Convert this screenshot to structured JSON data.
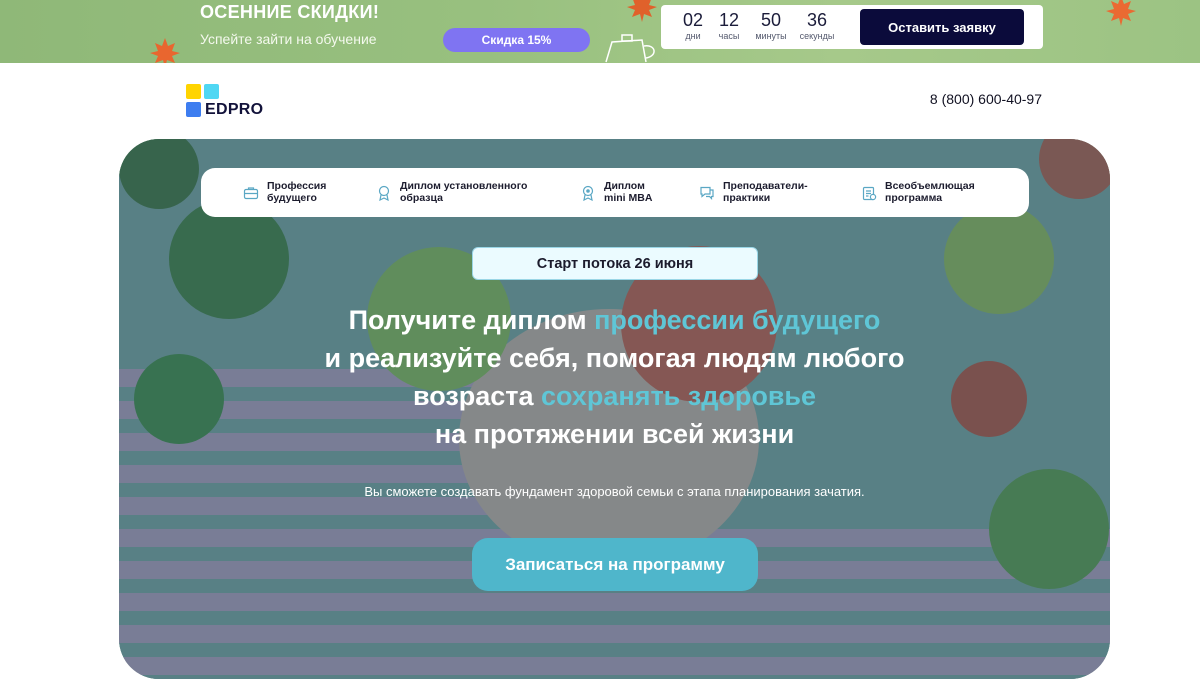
{
  "promo": {
    "title": "ОСЕННИЕ СКИДКИ!",
    "subtitle": "Успейте зайти на обучение",
    "discount_badge": "Скидка 15%",
    "timer": [
      {
        "value": "02",
        "label": "дни"
      },
      {
        "value": "12",
        "label": "часы"
      },
      {
        "value": "50",
        "label": "минуты"
      },
      {
        "value": "36",
        "label": "секунды"
      }
    ],
    "cta_label": "Оставить заявку",
    "colors": {
      "badge": "#7f74f2",
      "cta": "#0b0b3b",
      "leaf": "#e9662f"
    }
  },
  "header": {
    "logo_text": "EDPRO",
    "phone": "8 (800) 600-40-97"
  },
  "features": [
    {
      "icon": "briefcase-icon",
      "label": "Профессия\nбудущего"
    },
    {
      "icon": "award-icon",
      "label": "Диплом установленного\nобразца"
    },
    {
      "icon": "medal-icon",
      "label": "Диплом\nmini MBA"
    },
    {
      "icon": "chat-icon",
      "label": "Преподаватели-\nпрактики"
    },
    {
      "icon": "clipboard-icon",
      "label": "Всеобъемлющая\nпрограмма"
    }
  ],
  "hero": {
    "start_badge": "Старт потока 26 июня",
    "headline": {
      "line1_a": "Получите диплом ",
      "line1_accent": "профессии будущего",
      "line2": "и реализуйте себя, помогая людям любого",
      "line3_a": "возраста ",
      "line3_accent": "сохранять здоровье",
      "line4": "на протяжении всей жизни"
    },
    "subtitle": "Вы сможете создавать фундамент здоровой семьи с этапа планирования зачатия.",
    "cta_label": "Записаться на программу",
    "colors": {
      "accent": "#5fc6d6",
      "cta": "#4fb6cb"
    }
  }
}
